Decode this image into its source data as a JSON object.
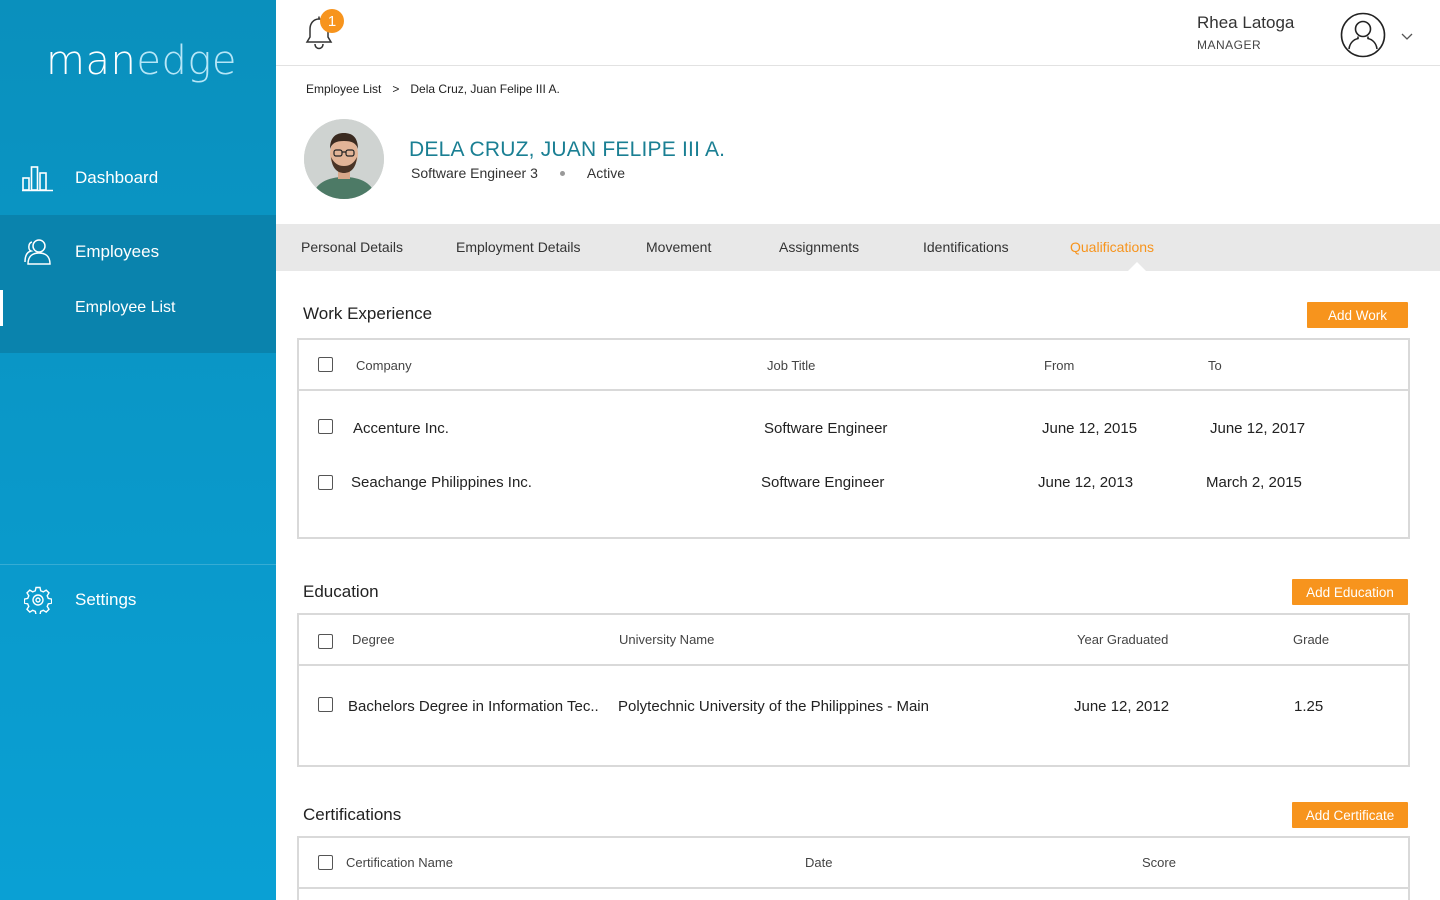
{
  "sidebar": {
    "logo_part1": "man",
    "logo_part2": "edge",
    "dashboard": "Dashboard",
    "employees": "Employees",
    "employee_list": "Employee List",
    "settings": "Settings"
  },
  "topbar": {
    "notification_count": "1",
    "user_name": "Rhea Latoga",
    "user_role": "MANAGER"
  },
  "breadcrumb": {
    "root": "Employee List",
    "separator": ">",
    "current": "Dela Cruz,  Juan Felipe III  A."
  },
  "profile": {
    "name": "DELA CRUZ, JUAN FELIPE III A.",
    "position": "Software Engineer 3",
    "status": "Active"
  },
  "tabs": [
    {
      "label": "Personal Details"
    },
    {
      "label": "Employment Details"
    },
    {
      "label": "Movement"
    },
    {
      "label": "Assignments"
    },
    {
      "label": "Identifications"
    },
    {
      "label": "Qualifications",
      "active": true
    }
  ],
  "work": {
    "title": "Work Experience",
    "add_label": "Add Work",
    "headers": {
      "company": "Company",
      "job_title": "Job Title",
      "from": "From",
      "to": "To"
    },
    "rows": [
      {
        "company": "Accenture Inc.",
        "job_title": "Software Engineer",
        "from": "June 12, 2015",
        "to": "June 12, 2017"
      },
      {
        "company": "Seachange Philippines Inc.",
        "job_title": "Software Engineer",
        "from": "June 12, 2013",
        "to": "March 2, 2015"
      }
    ]
  },
  "education": {
    "title": "Education",
    "add_label": "Add Education",
    "headers": {
      "degree": "Degree",
      "university": "University Name",
      "year": "Year Graduated",
      "grade": "Grade"
    },
    "rows": [
      {
        "degree": "Bachelors Degree in Information Tec..",
        "university": "Polytechnic University of the Philippines   - Main",
        "year": "June 12, 2012",
        "grade": "1.25"
      }
    ]
  },
  "certifications": {
    "title": "Certifications",
    "add_label": "Add Certificate",
    "headers": {
      "name": "Certification  Name",
      "date": "Date",
      "score": "Score"
    }
  },
  "colors": {
    "sidebar": "#0a97c9",
    "accent": "#f7941d",
    "name": "#1a7f93"
  }
}
